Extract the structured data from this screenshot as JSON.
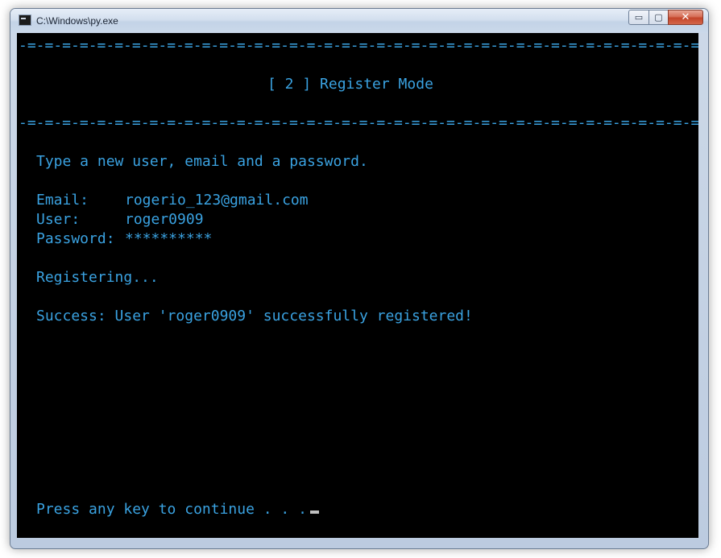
{
  "window": {
    "title": "C:\\Windows\\py.exe",
    "icon": "console-app-icon",
    "controls": {
      "minimize": "▭",
      "maximize": "▢",
      "close": "✕"
    }
  },
  "console": {
    "separator": "-=-=-=-=-=-=-=-=-=-=-=-=-=-=-=-=-=-=-=-=-=-=-=-=-=-=-=-=-=-=-=-=-=-=-=-=-=-=-=-",
    "heading": "[ 2 ] Register Mode",
    "prompt": "Type a new user, email and a password.",
    "email_label": "Email:",
    "email_value": "rogerio_123@gmail.com",
    "user_label": "User:",
    "user_value": "roger0909",
    "password_label": "Password:",
    "password_value": "**********",
    "status": "Registering...",
    "success": "Success: User 'roger0909' successfully registered!",
    "continue": "Press any key to continue . . ."
  },
  "colors": {
    "console_bg": "#000000",
    "console_text": "#3aa2e1",
    "cursor": "#c0c0c0"
  }
}
